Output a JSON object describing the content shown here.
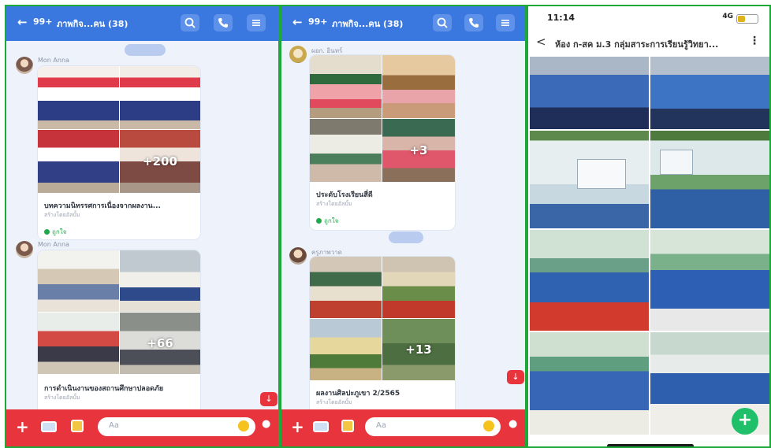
{
  "panel1": {
    "topbar": {
      "back_glyph": "←",
      "badge": "99+",
      "title": "ภาพกิจ...คน (38)",
      "icons": [
        "search-icon",
        "phone-icon",
        "menu-icon"
      ]
    },
    "date_pill": "",
    "post1": {
      "sender": "Mon Anna",
      "more_count": "+200",
      "caption": "บทความนิทรรศการเนื่องจากผลงาน...",
      "sub": "สร้างโดยอัลบั้ม",
      "like": "ถูกใจ",
      "time": ""
    },
    "post2": {
      "sender": "Mon Anna",
      "more_count": "+66",
      "caption": "การดำเนินงานของสถานศึกษาปลอดภัย",
      "sub": "สร้างโดยอัลบั้ม"
    },
    "input_placeholder": "Aa"
  },
  "panel2": {
    "topbar": {
      "back_glyph": "←",
      "badge": "99+",
      "title": "ภาพกิจ...คน (38)",
      "icons": [
        "search-icon",
        "phone-icon",
        "menu-icon"
      ]
    },
    "post1": {
      "sender": "ผอก. อินทร์",
      "more_count": "+3",
      "caption": "ประดับโรงเรียนสี่ดี",
      "sub": "สร้างโดยอัลบั้ม",
      "like": "ถูกใจ",
      "time": ""
    },
    "post2": {
      "sender": "ครูภาพวาด",
      "more_count": "+13",
      "caption": "ผลงานศิลปะภูเขา 2/2565",
      "sub": "สร้างโดยอัลบั้ม"
    },
    "input_placeholder": "Aa"
  },
  "panel3": {
    "status": {
      "time": "11:14",
      "signal": "4G"
    },
    "header_title": "ห้อง ก-สค ม.3 กลุ่มสาระการเรียนรู้วิทยา...",
    "back_glyph": "<",
    "fab_label": "+",
    "photo_count": 8
  },
  "colors": {
    "accent_blue": "#3a78e0",
    "accent_red": "#e8343c",
    "border_green": "#1fa83a",
    "fab_green": "#20c06a"
  }
}
